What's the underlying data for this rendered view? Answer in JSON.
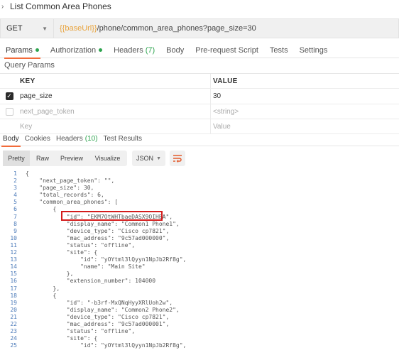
{
  "request": {
    "title": "List Common Area Phones",
    "method": "GET",
    "url_variable": "{{baseUrl}}",
    "url_path": "/phone/common_area_phones?page_size=30"
  },
  "request_tabs": [
    {
      "label": "Params",
      "active": true,
      "dot": true,
      "count": ""
    },
    {
      "label": "Authorization",
      "active": false,
      "dot": true,
      "count": ""
    },
    {
      "label": "Headers",
      "active": false,
      "dot": false,
      "count": "(7)"
    },
    {
      "label": "Body",
      "active": false,
      "dot": false,
      "count": ""
    },
    {
      "label": "Pre-request Script",
      "active": false,
      "dot": false,
      "count": ""
    },
    {
      "label": "Tests",
      "active": false,
      "dot": false,
      "count": ""
    },
    {
      "label": "Settings",
      "active": false,
      "dot": false,
      "count": ""
    }
  ],
  "query_params": {
    "label": "Query Params",
    "columns": {
      "key": "KEY",
      "value": "VALUE"
    },
    "rows": [
      {
        "checked": true,
        "key": "page_size",
        "value": "30",
        "placeholder": false
      },
      {
        "checked": false,
        "key": "next_page_token",
        "value": "<string>",
        "placeholder": true
      }
    ],
    "new_row": {
      "key": "Key",
      "value": "Value"
    }
  },
  "response_tabs": [
    {
      "label": "Body",
      "active": true,
      "count": ""
    },
    {
      "label": "Cookies",
      "active": false,
      "count": ""
    },
    {
      "label": "Headers",
      "active": false,
      "count": "(10)"
    },
    {
      "label": "Test Results",
      "active": false,
      "count": ""
    }
  ],
  "view_options": {
    "modes": [
      "Pretty",
      "Raw",
      "Preview",
      "Visualize"
    ],
    "active_mode": "Pretty",
    "format": "JSON",
    "wrap_icon": "wrap-lines-icon"
  },
  "code_lines": [
    {
      "n": "1",
      "text": "{"
    },
    {
      "n": "2",
      "text": "    \"next_page_token\": \"\","
    },
    {
      "n": "3",
      "text": "    \"page_size\": 30,"
    },
    {
      "n": "4",
      "text": "    \"total_records\": 6,"
    },
    {
      "n": "5",
      "text": "    \"common_area_phones\": ["
    },
    {
      "n": "6",
      "text": "        {"
    },
    {
      "n": "7",
      "text": "            \"id\": \"EKM7OtWHTbaeDASX9OIHBA\","
    },
    {
      "n": "8",
      "text": "            \"display_name\": \"Common1 Phone1\","
    },
    {
      "n": "9",
      "text": "            \"device_type\": \"Cisco cp7821\","
    },
    {
      "n": "10",
      "text": "            \"mac_address\": \"9c57ad000000\","
    },
    {
      "n": "11",
      "text": "            \"status\": \"offline\","
    },
    {
      "n": "12",
      "text": "            \"site\": {"
    },
    {
      "n": "13",
      "text": "                \"id\": \"yOYtml3lQyyn1NpJb2Rf8g\","
    },
    {
      "n": "14",
      "text": "                \"name\": \"Main Site\""
    },
    {
      "n": "15",
      "text": "            },"
    },
    {
      "n": "16",
      "text": "            \"extension_number\": 104000"
    },
    {
      "n": "17",
      "text": "        },"
    },
    {
      "n": "18",
      "text": "        {"
    },
    {
      "n": "19",
      "text": "            \"id\": \"-b3rf-MxQNqHyyXRlUoh2w\","
    },
    {
      "n": "20",
      "text": "            \"display_name\": \"Common2 Phone2\","
    },
    {
      "n": "21",
      "text": "            \"device_type\": \"Cisco cp7821\","
    },
    {
      "n": "22",
      "text": "            \"mac_address\": \"9c57ad000001\","
    },
    {
      "n": "23",
      "text": "            \"status\": \"offline\","
    },
    {
      "n": "24",
      "text": "            \"site\": {"
    },
    {
      "n": "25",
      "text": "                \"id\": \"yOYtml3lQyyn1NpJb2Rf8g\","
    }
  ],
  "colors": {
    "accent_tab": "#f26b3a",
    "status_dot": "#2ea44f",
    "url_variable": "#e8a33d",
    "highlight": "#d31c1c",
    "line_numbers": "#4a79b8"
  }
}
